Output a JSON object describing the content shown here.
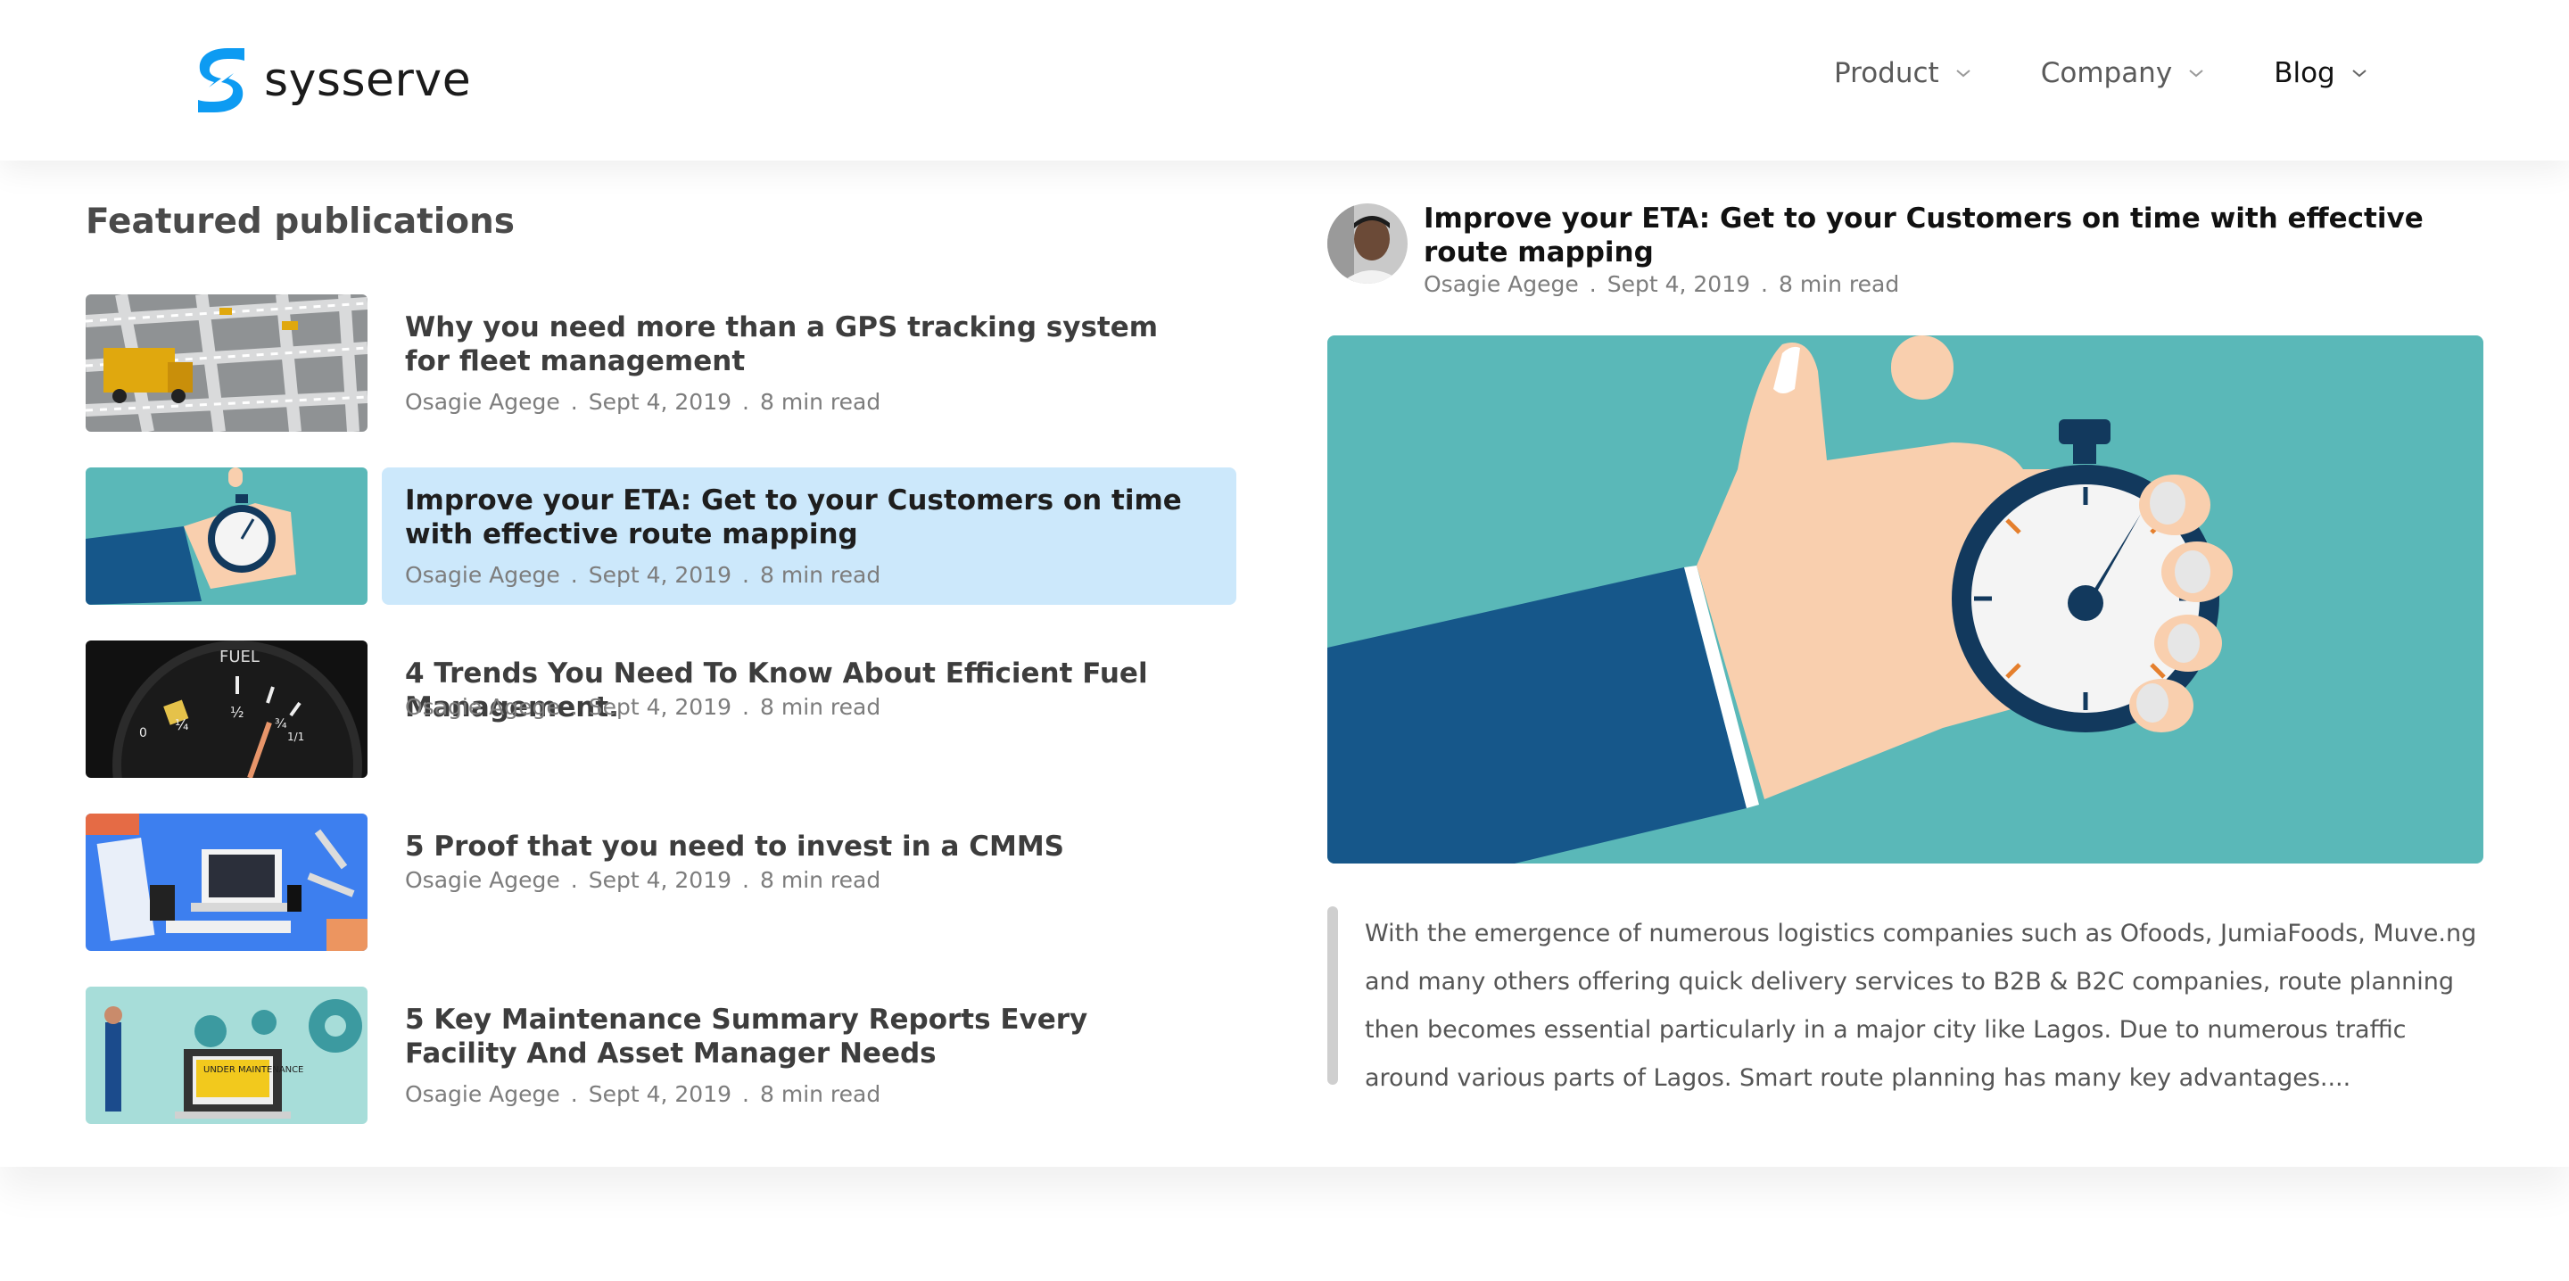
{
  "brand": {
    "name": "sysserve",
    "color": "#0d9bf2"
  },
  "nav": [
    {
      "label": "Product",
      "active": false
    },
    {
      "label": "Company",
      "active": false
    },
    {
      "label": "Blog",
      "active": true
    }
  ],
  "featured_publications": {
    "heading": "Featured publications",
    "items": [
      {
        "title": "Why you need more than a GPS tracking system for fleet management",
        "author": "Osagie Agege",
        "date": "Sept 4, 2019",
        "read_time": "8 min read",
        "thumbnail": "truck-on-map-image",
        "selected": false
      },
      {
        "title": "Improve your ETA: Get to your Customers on time with effective route mapping",
        "author": "Osagie Agege",
        "date": "Sept 4, 2019",
        "read_time": "8 min read",
        "thumbnail": "stopwatch-hand-image",
        "selected": true
      },
      {
        "title": "4 Trends You Need To Know About Efficient Fuel Management.",
        "author": "Osagie Agege",
        "date": "Sept 4, 2019",
        "read_time": "8 min read",
        "thumbnail": "fuel-gauge-image",
        "selected": false
      },
      {
        "title": "5 Proof that you need to invest in a CMMS",
        "author": "Osagie Agege",
        "date": "Sept 4, 2019",
        "read_time": "8 min read",
        "thumbnail": "tools-laptop-image",
        "selected": false
      },
      {
        "title": "5 Key Maintenance Summary Reports Every Facility And Asset Manager Needs",
        "author": "Osagie Agege",
        "date": "Sept 4, 2019",
        "read_time": "8 min read",
        "thumbnail": "under-maintenance-image",
        "selected": false
      }
    ]
  },
  "gauge_labels": {
    "fuel": "FUEL",
    "empty": "0",
    "quarter": "¼",
    "half": "½",
    "three_quarter": "¾",
    "full": "1/1"
  },
  "maintenance_sign": "UNDER MAINTENANCE",
  "featured_article": {
    "title": "Improve your ETA: Get to your Customers on time with effective route mapping",
    "author": "Osagie Agege",
    "date": "Sept 4, 2019",
    "read_time": "8 min read",
    "excerpt": "With the emergence of numerous logistics companies such as Ofoods, JumiaFoods, Muve.ng and many others offering quick delivery services to B2B & B2C companies, route planning then becomes essential particularly in a major city like Lagos. Due to numerous traffic around various parts of Lagos. Smart route planning has many key advantages...."
  },
  "colors": {
    "highlight": "#cce8fb",
    "teal": "#5ab8b8",
    "navy": "#16578a"
  }
}
